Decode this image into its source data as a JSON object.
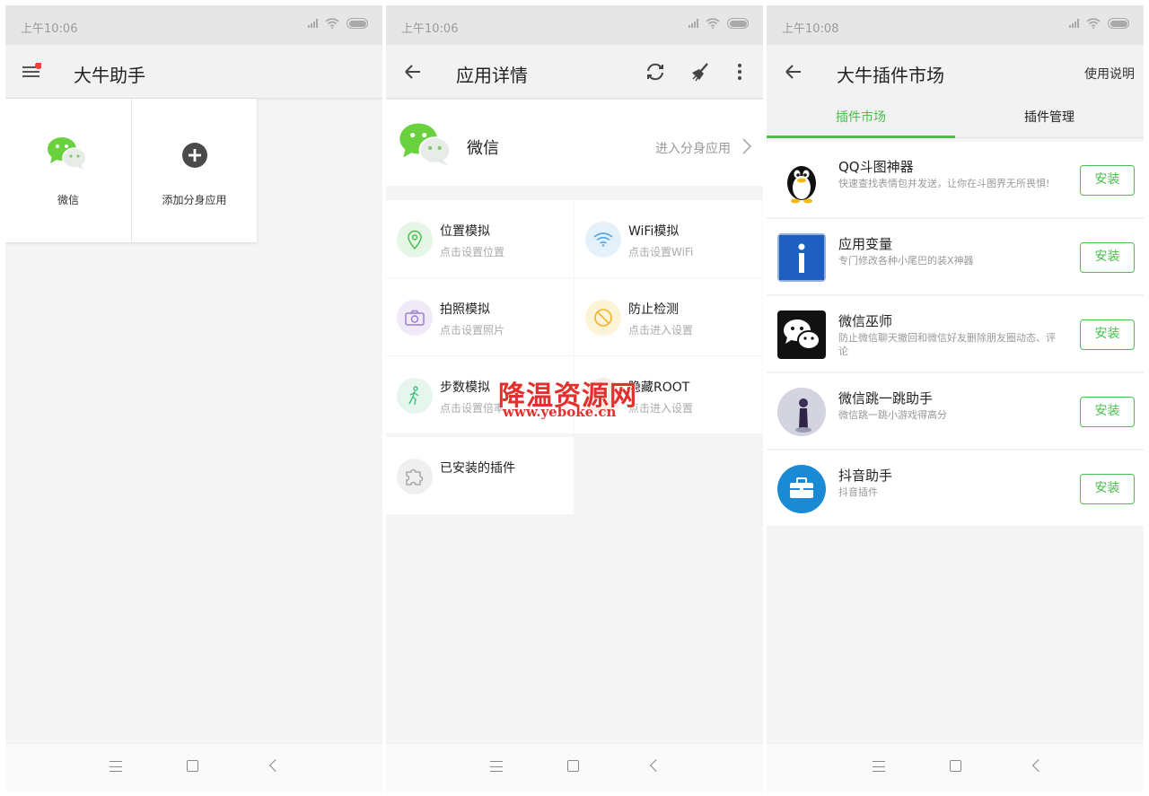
{
  "colors": {
    "accent_green": "#47c04d",
    "red_dot": "#f24040",
    "status_bg": "#e6e6e6",
    "wechat_green": "#6ad13e"
  },
  "screen1": {
    "status_time": "上午10:06",
    "title": "大牛助手",
    "tiles": [
      {
        "label": "微信",
        "icon": "wechat-icon"
      },
      {
        "label": "添加分身应用",
        "icon": "add-circle-icon"
      }
    ]
  },
  "screen2": {
    "status_time": "上午10:06",
    "title": "应用详情",
    "app_name": "微信",
    "open_clone": "进入分身应用",
    "features": [
      {
        "title": "位置模拟",
        "sub": "点击设置位置",
        "icon": "location-pin-icon"
      },
      {
        "title": "WiFi模拟",
        "sub": "点击设置WiFi",
        "icon": "wifi-icon"
      },
      {
        "title": "拍照模拟",
        "sub": "点击设置照片",
        "icon": "camera-icon"
      },
      {
        "title": "防止检测",
        "sub": "点击进入设置",
        "icon": "block-icon"
      },
      {
        "title": "步数模拟",
        "sub": "点击设置倍率",
        "icon": "walking-icon"
      },
      {
        "title": "隐藏ROOT",
        "sub": "点击进入设置",
        "icon": "root-icon"
      },
      {
        "title": "已安装的插件",
        "sub": "",
        "icon": "puzzle-icon"
      }
    ]
  },
  "screen3": {
    "status_time": "上午10:08",
    "title": "大牛插件市场",
    "help": "使用说明",
    "tabs": [
      "插件市场",
      "插件管理"
    ],
    "install_label": "安装",
    "plugins": [
      {
        "name": "QQ斗图神器",
        "desc": "快速查找表情包并发送，让你在斗图界无所畏惧!",
        "icon": "penguin-icon"
      },
      {
        "name": "应用变量",
        "desc": "专门修改各种小尾巴的装X神器",
        "icon": "info-i-icon"
      },
      {
        "name": "微信巫师",
        "desc": "防止微信聊天撤回和微信好友删除朋友圈动态、评论",
        "icon": "wechat-dark-icon"
      },
      {
        "name": "微信跳一跳助手",
        "desc": "微信跳一跳小游戏得高分",
        "icon": "jump-game-icon"
      },
      {
        "name": "抖音助手",
        "desc": "抖音插件",
        "icon": "toolbox-icon"
      }
    ]
  },
  "watermark": {
    "title": "降温资源网",
    "url": "www.yeboke.cn"
  }
}
